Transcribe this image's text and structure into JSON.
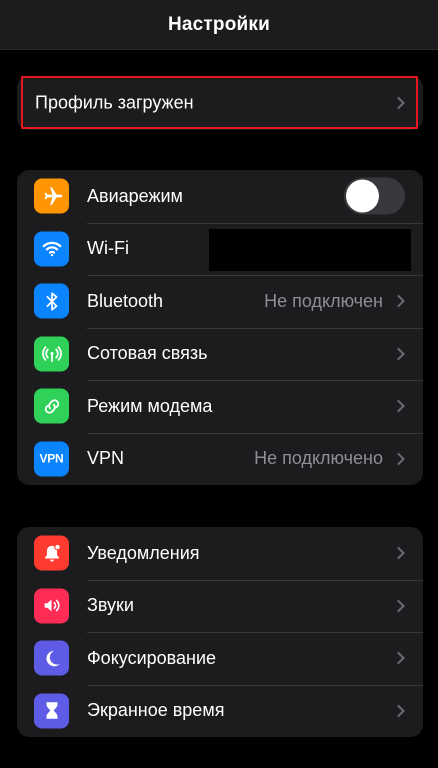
{
  "header": {
    "title": "Настройки"
  },
  "profile": {
    "label": "Профиль загружен"
  },
  "network": {
    "airplane": {
      "label": "Авиарежим",
      "toggle_on": false,
      "icon": "airplane-icon",
      "color": "#ff9500"
    },
    "wifi": {
      "label": "Wi-Fi",
      "icon": "wifi-icon",
      "color": "#0a84ff"
    },
    "bluetooth": {
      "label": "Bluetooth",
      "value": "Не подключен",
      "icon": "bluetooth-icon",
      "color": "#0a84ff"
    },
    "cellular": {
      "label": "Сотовая связь",
      "icon": "cellular-antenna-icon",
      "color": "#30d158"
    },
    "hotspot": {
      "label": "Режим модема",
      "icon": "hotspot-chain-icon",
      "color": "#30d158"
    },
    "vpn": {
      "label": "VPN",
      "value": "Не подключено",
      "icon_text": "VPN",
      "color": "#0a84ff"
    }
  },
  "general": {
    "notifications": {
      "label": "Уведомления",
      "icon": "notification-bell-icon",
      "color": "#ff3b30"
    },
    "sounds": {
      "label": "Звуки",
      "icon": "speaker-icon",
      "color": "#ff2d55"
    },
    "focus": {
      "label": "Фокусирование",
      "icon": "moon-icon",
      "color": "#5e5ce6"
    },
    "screentime": {
      "label": "Экранное время",
      "icon": "hourglass-icon",
      "color": "#5e5ce6"
    }
  }
}
